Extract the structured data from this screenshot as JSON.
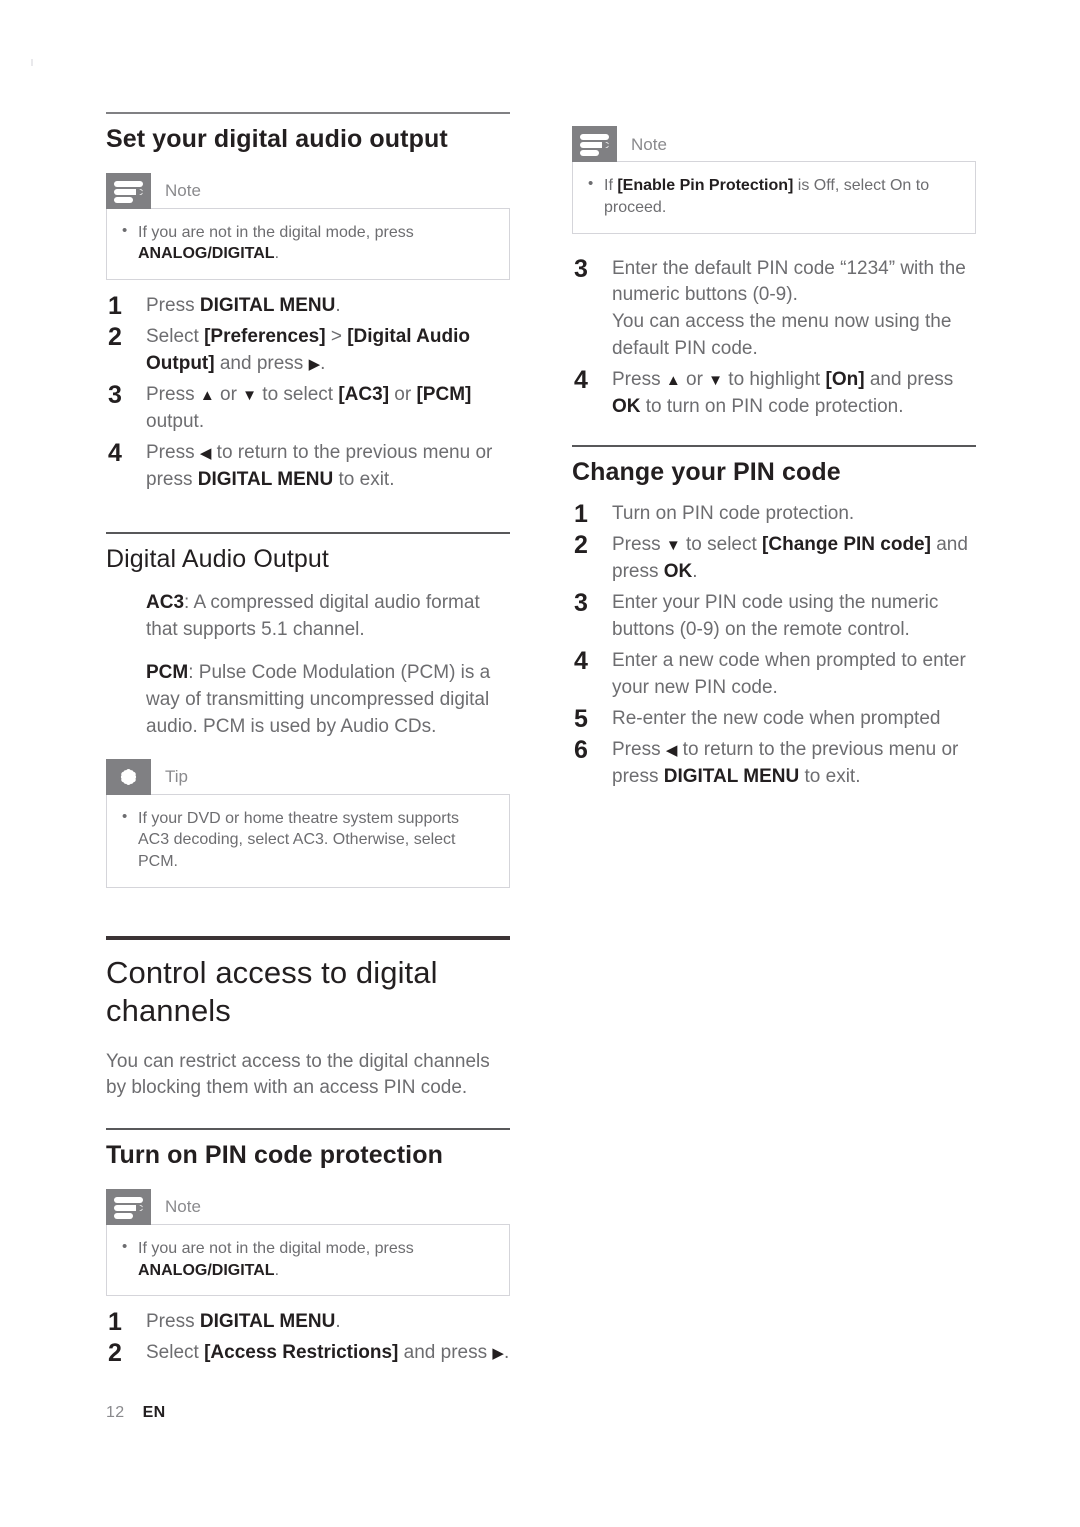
{
  "page": {
    "number": "12",
    "language": "EN"
  },
  "left_column": {
    "section1": {
      "heading": "Set your digital audio output",
      "note": {
        "label": "Note",
        "icon": "note-icon",
        "items_html": "If you are not in the digital mode, press <b>ANALOG/DIGITAL</b>."
      },
      "steps": [
        "Press <b>DIGITAL MENU</b>.",
        "Select <b>[Preferences]</b> &gt; <b>[Digital Audio Output]</b> and press <span class=\"arrow\">▶</span>.",
        "Press <span class=\"arrow\">▲</span> or <span class=\"arrow\">▼</span> to select <b>[AC3]</b> or <b>[PCM]</b> output.",
        "Press <span class=\"arrow\">◀</span> to return to the previous menu or press <b>DIGITAL MENU</b> to exit."
      ]
    },
    "section2": {
      "heading": "Digital Audio Output",
      "definitions": [
        "<b>AC3</b>: A compressed digital audio format that supports 5.1 channel.",
        "<b>PCM</b>: Pulse Code Modulation (PCM) is a way of transmitting uncompressed digital audio. PCM is used by Audio CDs."
      ],
      "tip": {
        "label": "Tip",
        "icon": "tip-icon",
        "items_html": "If your DVD or home theatre system supports AC3 decoding, select AC3. Otherwise, select PCM."
      }
    },
    "chapter": {
      "title": "Control access to digital channels",
      "intro": "You can restrict access to the digital channels by blocking them with an access PIN code."
    },
    "section3": {
      "heading": "Turn on PIN code protection",
      "note": {
        "label": "Note",
        "icon": "note-icon",
        "items_html": "If you are not in the digital mode, press <b>ANALOG/DIGITAL</b>."
      },
      "steps": [
        "Press <b>DIGITAL MENU</b>.",
        "Select <b>[Access Restrictions]</b> and press <span class=\"arrow\">▶</span>."
      ]
    }
  },
  "right_column": {
    "note": {
      "label": "Note",
      "icon": "note-icon",
      "items_html": "If <b>[Enable Pin Protection]</b> is Off, select On to proceed."
    },
    "steps_continued": [
      "Enter the default PIN code “1234” with the numeric buttons (0-9).<br>You can access the menu now using the default PIN code.",
      "Press <span class=\"arrow\">▲</span> or <span class=\"arrow\">▼</span> to highlight <b>[On]</b> and press <b>OK</b> to turn on PIN code protection."
    ],
    "section4": {
      "heading": "Change your PIN code",
      "steps": [
        "Turn on PIN code protection.",
        "Press <span class=\"arrow\">▼</span> to select <b>[Change PIN code]</b> and press <b>OK</b>.",
        "Enter your PIN code using the numeric buttons (0-9) on the remote control.",
        "Enter a new code when prompted to enter your new PIN code.",
        "Re-enter the new code when prompted",
        "Press <span class=\"arrow\">◀</span> to return to the previous menu or press <b>DIGITAL MENU</b> to exit."
      ]
    }
  },
  "colors": {
    "icon_box": "#808083",
    "heading": "#231f20",
    "body_text": "#6d6d70",
    "rule_thick": "#3b3335",
    "box_border": "#d5d5da"
  }
}
